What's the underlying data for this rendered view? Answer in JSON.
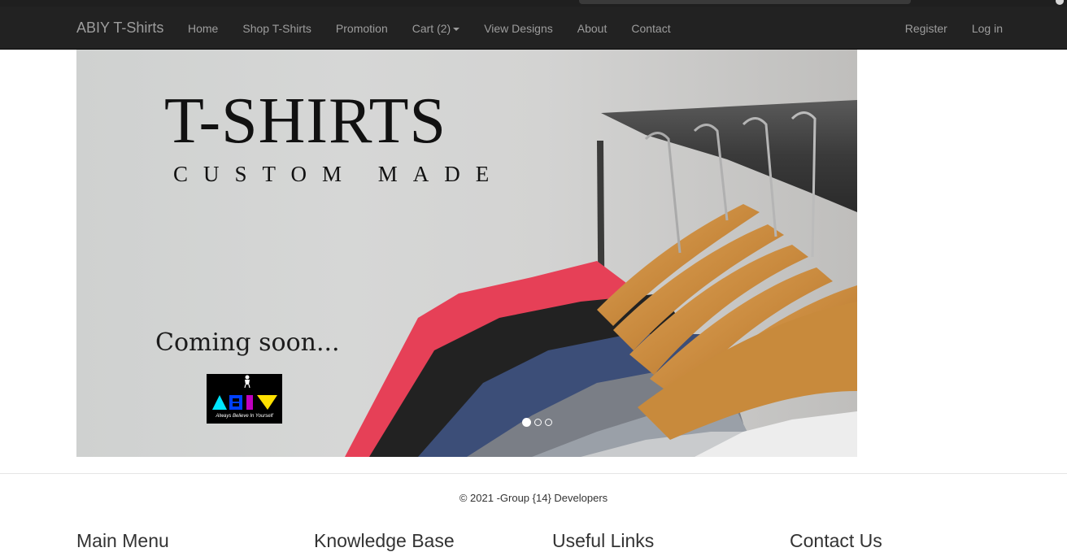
{
  "navbar": {
    "brand": "ABIY T-Shirts",
    "left_links": [
      "Home",
      "Shop T-Shirts",
      "Promotion",
      "Cart (2)",
      "View Designs",
      "About",
      "Contact"
    ],
    "right_links": [
      "Register",
      "Log in"
    ]
  },
  "carousel": {
    "title": "T-SHIRTS",
    "subtitle": "CUSTOM MADE",
    "coming_soon": "Coming soon...",
    "logo": {
      "letters": "ABIY",
      "tagline": "Always Believe In Yourself"
    },
    "slide_count": 3,
    "active_slide": 1
  },
  "footer": {
    "copyright": "© 2021 -Group {14} Developers",
    "headings": [
      "Main Menu",
      "Knowledge Base",
      "Useful Links",
      "Contact Us"
    ]
  },
  "colors": {
    "navbar_bg": "#222222",
    "nav_text": "#9d9d9d",
    "logo_cyan": "#00e5ff",
    "logo_magenta": "#c000c0",
    "logo_yellow": "#ffe000"
  },
  "icons": [
    "cart-caret-icon",
    "abiy-mascot-icon"
  ]
}
